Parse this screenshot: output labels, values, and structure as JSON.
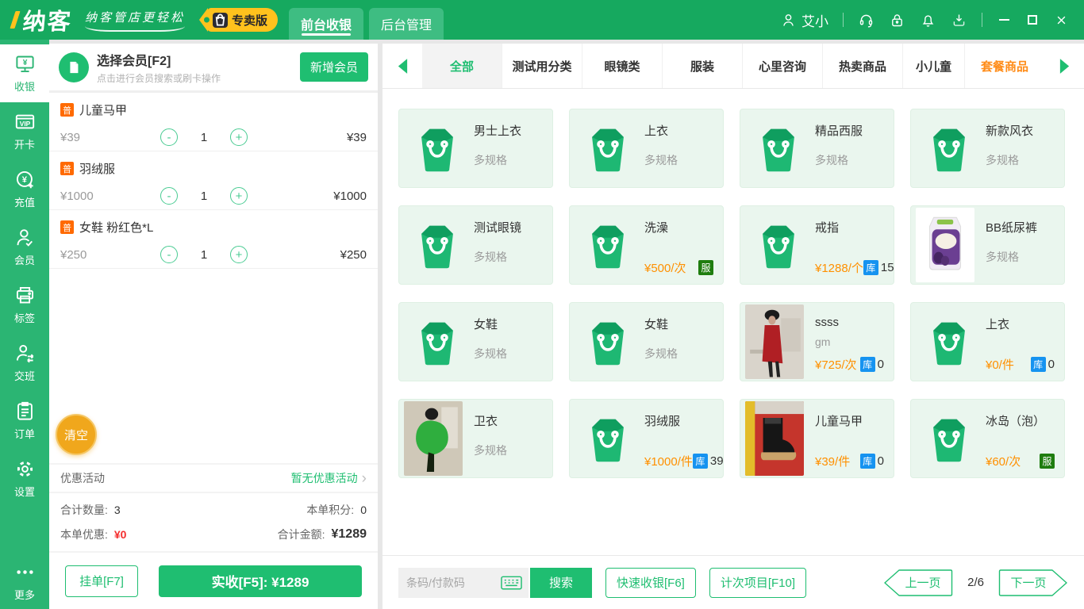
{
  "colors": {
    "accent": "#1fbe71",
    "topbar_green": "#16a95f",
    "sidebar_green": "#2bb573",
    "price_orange": "#ff9000",
    "service_badge_green": "#1f7d0f",
    "stock_badge_blue": "#1693f0",
    "clear_button_orange": "#f0a71c",
    "item_tag_orange": "#ff6a00",
    "package_tab_orange": "#ff8d1a",
    "discount_red": "#f42e2e"
  },
  "topbar": {
    "brand": "纳客",
    "slogan": "纳客管店更轻松",
    "edition": "专卖版",
    "nav_tabs": [
      {
        "label": "前台收银",
        "active": true
      },
      {
        "label": "后台管理"
      }
    ],
    "user": "艾小"
  },
  "sidebar": {
    "items": [
      {
        "label": "收银",
        "icon": "cash-register",
        "active": true
      },
      {
        "label": "开卡",
        "icon": "vip-card"
      },
      {
        "label": "充值",
        "icon": "recharge"
      },
      {
        "label": "会员",
        "icon": "member"
      },
      {
        "label": "标签",
        "icon": "printer"
      },
      {
        "label": "交班",
        "icon": "shift"
      },
      {
        "label": "订单",
        "icon": "orders"
      },
      {
        "label": "设置",
        "icon": "settings"
      },
      {
        "label": "更多",
        "icon": "more"
      }
    ]
  },
  "cart": {
    "member_title": "选择会员[F2]",
    "member_subtitle": "点击进行会员搜索或刷卡操作",
    "add_member": "新增会员",
    "items": [
      {
        "tag": "普",
        "name": "儿童马甲",
        "price": "¥39",
        "qty": "1",
        "total": "¥39"
      },
      {
        "tag": "普",
        "name": "羽绒服",
        "price": "¥1000",
        "qty": "1",
        "total": "¥1000"
      },
      {
        "tag": "普",
        "name": "女鞋 粉红色*L",
        "price": "¥250",
        "qty": "1",
        "total": "¥250"
      }
    ],
    "clear": "清空",
    "promo_label": "优惠活动",
    "promo_value": "暂无优惠活动",
    "summary": {
      "qty_label": "合计数量:",
      "qty": "3",
      "points_label": "本单积分:",
      "points": "0",
      "discount_label": "本单优惠:",
      "discount": "¥0",
      "amount_label": "合计金额:",
      "amount": "¥1289"
    },
    "hold": "挂单[F7]",
    "pay": "实收[F5]: ¥1289"
  },
  "catalog": {
    "tabs": [
      {
        "label": "全部",
        "active": true
      },
      {
        "label": "测试用分类"
      },
      {
        "label": "眼镜类"
      },
      {
        "label": "服装"
      },
      {
        "label": "心里咨询"
      },
      {
        "label": "热卖商品"
      },
      {
        "label": "小儿童",
        "truncated": true
      },
      {
        "label": "套餐商品",
        "highlight": true
      }
    ],
    "products": [
      {
        "name": "男士上衣",
        "spec": "多规格",
        "is_bag": true
      },
      {
        "name": "上衣",
        "spec": "多规格",
        "is_bag": true
      },
      {
        "name": "精品西服",
        "spec": "多规格",
        "is_bag": true
      },
      {
        "name": "新款风衣",
        "spec": "多规格",
        "is_bag": true
      },
      {
        "name": "测试眼镜",
        "spec": "多规格",
        "is_bag": true
      },
      {
        "name": "洗澡",
        "price": "¥500/次",
        "is_bag": true,
        "badge": {
          "text": "服",
          "type": "svc"
        }
      },
      {
        "name": "戒指",
        "price": "¥1288/个",
        "is_bag": true,
        "badge": {
          "text": "库",
          "type": "stock"
        },
        "stock": "15"
      },
      {
        "name": "BB纸尿裤",
        "spec": "多规格",
        "photo": "diaper"
      },
      {
        "name": "女鞋",
        "spec": "多规格",
        "is_bag": true
      },
      {
        "name": "女鞋",
        "spec": "多规格",
        "is_bag": true
      },
      {
        "name": "ssss",
        "spec": "gm",
        "price": "¥725/次",
        "photo": "redcoat",
        "badge": {
          "text": "库",
          "type": "stock"
        },
        "stock": "0"
      },
      {
        "name": "上衣",
        "price": "¥0/件",
        "is_bag": true,
        "badge": {
          "text": "库",
          "type": "stock"
        },
        "stock": "0"
      },
      {
        "name": "卫衣",
        "spec": "多规格",
        "photo": "hoodie"
      },
      {
        "name": "羽绒服",
        "price": "¥1000/件",
        "is_bag": true,
        "badge": {
          "text": "库",
          "type": "stock"
        },
        "stock": "39"
      },
      {
        "name": "儿童马甲",
        "price": "¥39/件",
        "photo": "boot",
        "badge": {
          "text": "库",
          "type": "stock"
        },
        "stock": "0"
      },
      {
        "name": "冰岛（泡）",
        "price": "¥60/次",
        "is_bag": true,
        "badge": {
          "text": "服",
          "type": "svc"
        }
      }
    ],
    "footer": {
      "placeholder": "条码/付款码",
      "search": "搜索",
      "quick": "快速收银[F6]",
      "counting": "计次项目[F10]",
      "prev": "上一页",
      "page": "2/6",
      "next": "下一页"
    }
  }
}
